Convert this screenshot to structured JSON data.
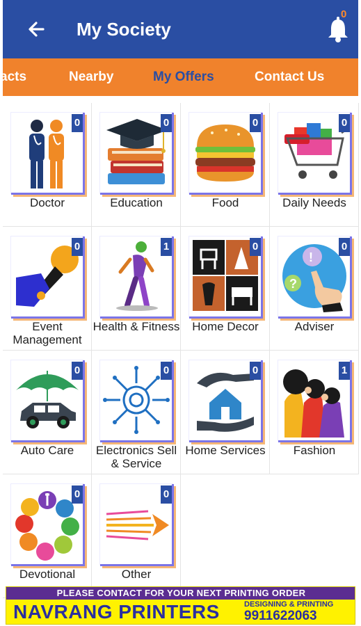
{
  "appbar": {
    "title": "My Society",
    "notification_count": "0"
  },
  "tabs": [
    {
      "label": "acts"
    },
    {
      "label": "Nearby"
    },
    {
      "label": "My Offers"
    },
    {
      "label": "Contact Us"
    }
  ],
  "categories": [
    {
      "label": "Doctor",
      "count": "0",
      "icon": "doctor-icon"
    },
    {
      "label": "Education",
      "count": "0",
      "icon": "education-icon"
    },
    {
      "label": "Food",
      "count": "0",
      "icon": "food-icon"
    },
    {
      "label": "Daily Needs",
      "count": "0",
      "icon": "shopping-cart-icon"
    },
    {
      "label": "Event Management",
      "count": "0",
      "icon": "microphone-icon"
    },
    {
      "label": "Health & Fitness",
      "count": "1",
      "icon": "fitness-icon"
    },
    {
      "label": "Home Decor",
      "count": "0",
      "icon": "home-decor-icon"
    },
    {
      "label": "Adviser",
      "count": "0",
      "icon": "adviser-icon"
    },
    {
      "label": "Auto Care",
      "count": "0",
      "icon": "car-umbrella-icon"
    },
    {
      "label": "Electronics Sell & Service",
      "count": "0",
      "icon": "circuit-icon"
    },
    {
      "label": "Home Services",
      "count": "0",
      "icon": "home-hands-icon"
    },
    {
      "label": "Fashion",
      "count": "1",
      "icon": "fashion-icon"
    },
    {
      "label": "Devotional",
      "count": "0",
      "icon": "religions-flower-icon"
    },
    {
      "label": "Other",
      "count": "0",
      "icon": "arrows-icon"
    }
  ],
  "banner": {
    "top_line": "PLEASE CONTACT FOR YOUR NEXT PRINTING ORDER",
    "brand": "NAVRANG PRINTERS",
    "tagline": "DESIGNING & PRINTING",
    "phone": "9911622063"
  },
  "colors": {
    "primary": "#2a4ea3",
    "accent": "#f0822c",
    "banner_bg": "#fff200"
  }
}
